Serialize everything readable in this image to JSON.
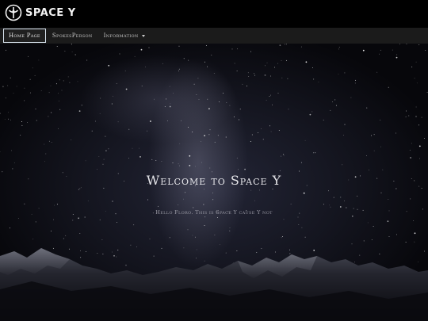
{
  "brand": {
    "name": "SPACE Y",
    "logo_icon": "space-y-emblem-icon"
  },
  "nav": {
    "items": [
      {
        "label": "Home Page",
        "active": true
      },
      {
        "label": "SpokesPerson",
        "active": false
      },
      {
        "label": "Information",
        "active": false,
        "dropdown": true
      }
    ]
  },
  "hero": {
    "title": "Welcome to Space Y",
    "subtitle": "Hello Floro. This is Space Y cause Y not",
    "background": "night-sky-milky-way-over-mountains"
  },
  "colors": {
    "header_bg": "#000000",
    "navbar_bg": "#1b1b1b",
    "nav_text": "#c8c8c8",
    "active_border": "#d9e4ef",
    "hero_title": "#e6e6ea"
  }
}
